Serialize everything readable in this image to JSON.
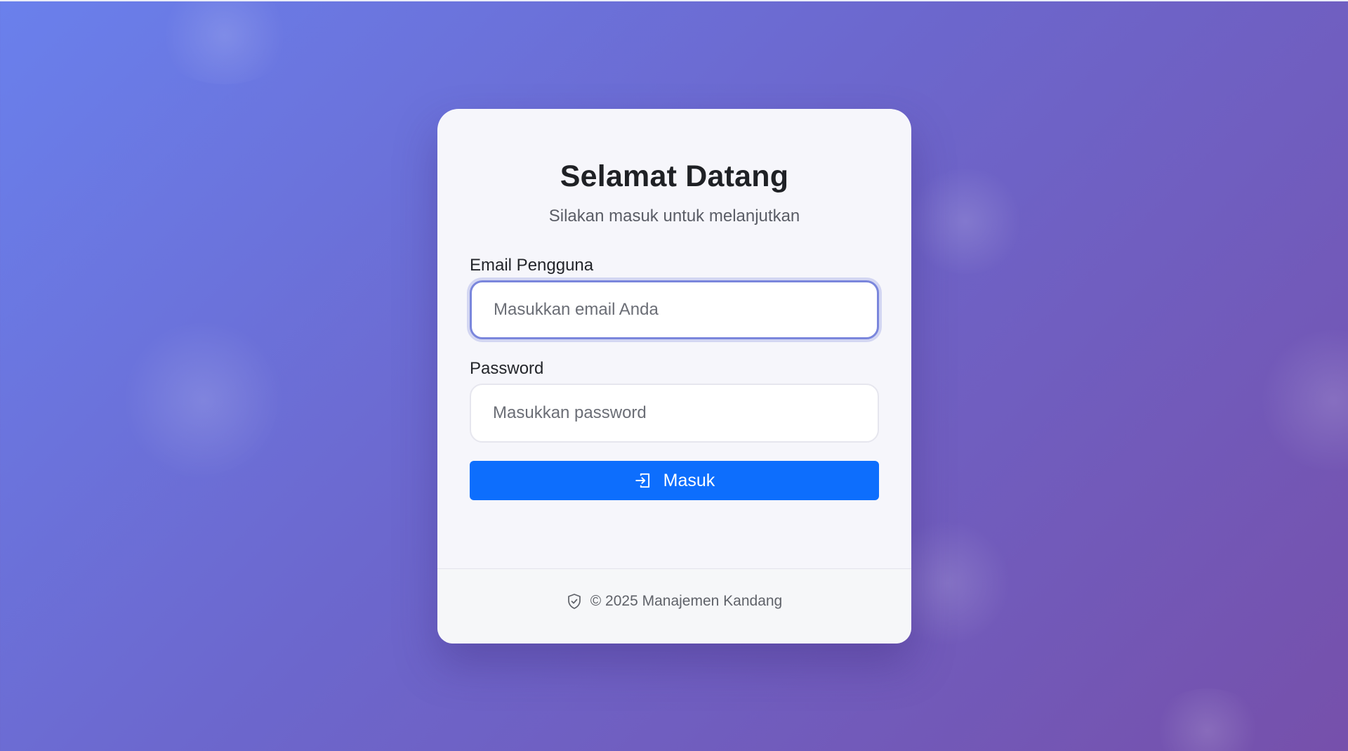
{
  "card": {
    "title": "Selamat Datang",
    "subtitle": "Silakan masuk untuk melanjutkan"
  },
  "form": {
    "email_label": "Email Pengguna",
    "email_placeholder": "Masukkan email Anda",
    "email_value": "",
    "password_label": "Password",
    "password_placeholder": "Masukkan password",
    "password_value": "",
    "submit_label": "Masuk",
    "submit_icon": "sign-in-icon"
  },
  "footer": {
    "icon": "shield-check-icon",
    "text": "© 2025 Manajemen Kandang"
  },
  "colors": {
    "primary": "#0d6efd",
    "focus_ring": "#7a86dc",
    "background_start": "#6a80ec",
    "background_end": "#7650ab"
  }
}
